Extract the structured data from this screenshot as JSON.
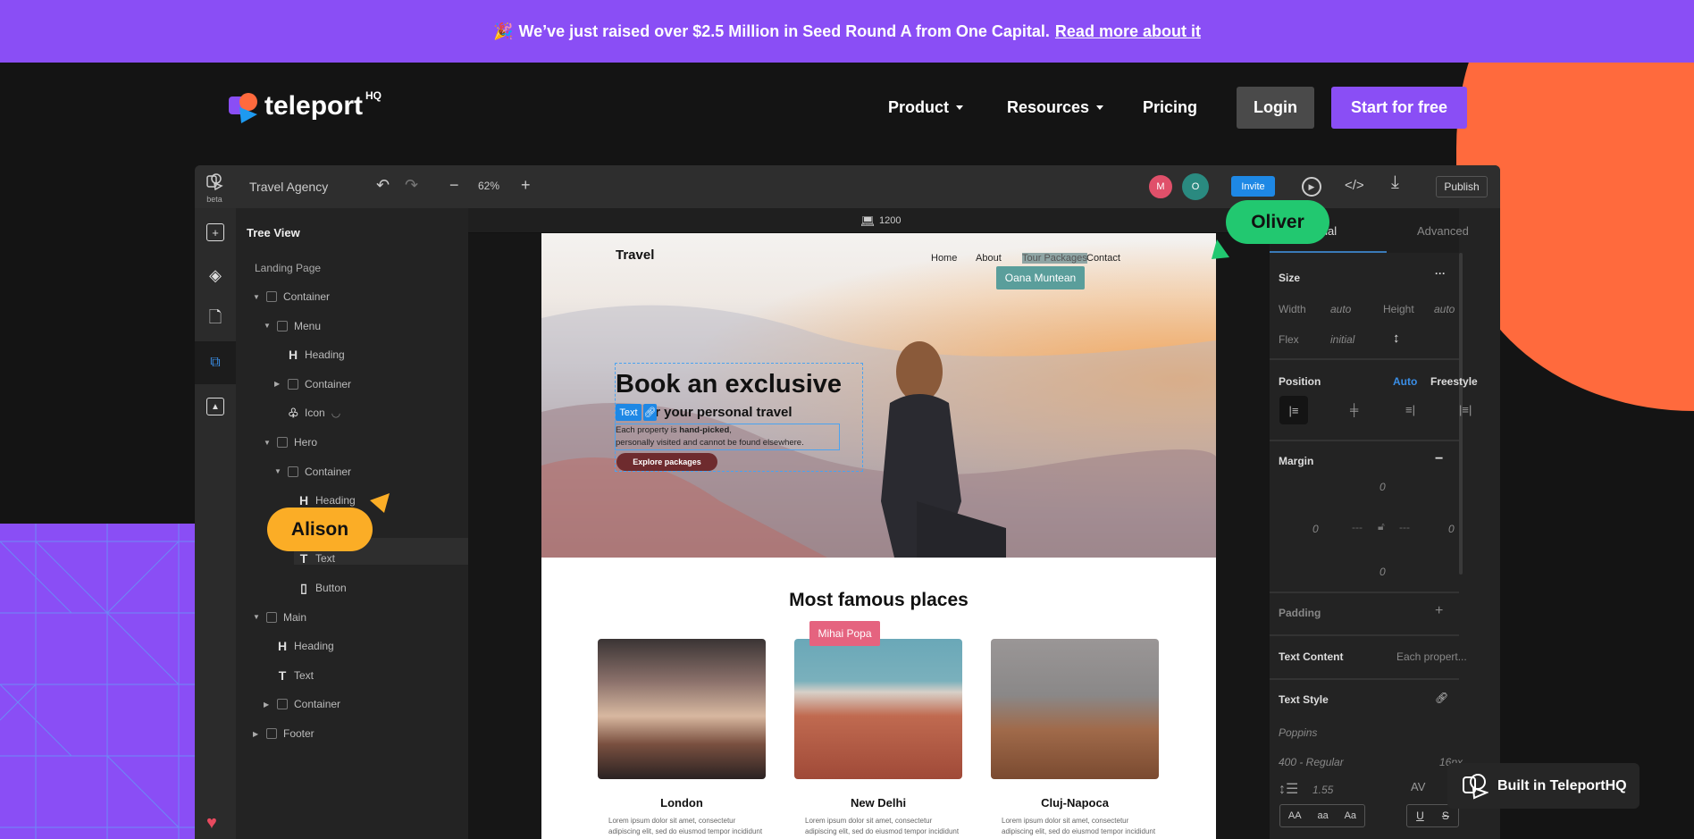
{
  "banner": {
    "emoji": "🎉",
    "text": "We’ve just raised over $2.5 Million in Seed Round A from One Capital.",
    "link": "Read more about it"
  },
  "nav": {
    "logo": "teleport",
    "logo_sup": "HQ",
    "items": [
      {
        "label": "Product",
        "dropdown": true
      },
      {
        "label": "Resources",
        "dropdown": true
      },
      {
        "label": "Pricing",
        "dropdown": false
      }
    ],
    "login": "Login",
    "start": "Start for free"
  },
  "colors": {
    "purple": "#8a4ef5",
    "orange": "#ff6a3d",
    "oliver": "#22c870",
    "alison": "#fbad26",
    "oana": "#5a9e9b",
    "mihai": "#e5637f",
    "accent_blue": "#1e88e5"
  },
  "editor": {
    "beta": "beta",
    "project": "Travel Agency",
    "zoom": "62%",
    "avatars": [
      "M",
      "O"
    ],
    "invite": "Invite",
    "publish": "Publish",
    "viewport_width": "1200",
    "tree": {
      "title": "Tree View",
      "page": "Landing Page",
      "rows": [
        {
          "label": "Container",
          "icon": "box",
          "caret": "down"
        },
        {
          "label": "Menu",
          "icon": "box",
          "caret": "down"
        },
        {
          "label": "Heading",
          "icon": "H"
        },
        {
          "label": "Container",
          "icon": "box",
          "caret": "right"
        },
        {
          "label": "Icon",
          "icon": "shapes",
          "hidden": true
        },
        {
          "label": "Hero",
          "icon": "box",
          "caret": "down"
        },
        {
          "label": "Container",
          "icon": "box",
          "caret": "down"
        },
        {
          "label": "Heading",
          "icon": "H"
        },
        {
          "label": "Text",
          "icon": "T",
          "selected": true
        },
        {
          "label": "Button",
          "icon": "button"
        },
        {
          "label": "Main",
          "icon": "box",
          "caret": "down"
        },
        {
          "label": "Heading",
          "icon": "H"
        },
        {
          "label": "Text",
          "icon": "T"
        },
        {
          "label": "Container",
          "icon": "box",
          "caret": "right"
        },
        {
          "label": "Footer",
          "icon": "box",
          "caret": "right"
        }
      ]
    },
    "panel": {
      "tabs": [
        "Visual",
        "Advanced"
      ],
      "active_tab": "Visual",
      "size": "Size",
      "width_label": "Width",
      "width": "auto",
      "height_label": "Height",
      "height": "auto",
      "flex_label": "Flex",
      "flex": "initial",
      "position": "Position",
      "pos_auto": "Auto",
      "pos_free": "Freestyle",
      "margin": "Margin",
      "margin_vals": {
        "top": "0",
        "left": "0",
        "right": "0",
        "bottom": "0"
      },
      "padding": "Padding",
      "text_content": "Text Content",
      "text_content_val": "Each propert...",
      "text_style": "Text Style",
      "font": "Poppins",
      "weight": "400 - Regular",
      "size_px": "16px",
      "line_height": "1.55",
      "case_btns": [
        "AA",
        "aa",
        "Aa"
      ]
    }
  },
  "site": {
    "brand": "Travel",
    "menu": [
      "Home",
      "About",
      "Tour Packages",
      "Contact"
    ],
    "hero_title": "Book an exclusive",
    "hero_sub": "or your personal travel",
    "hero_text_a": "Each property is ",
    "hero_text_b": "hand-picked",
    "hero_text_c": ",",
    "hero_text_d": "personally visited and cannot be found elsewhere.",
    "hero_btn": "Explore packages",
    "text_chip": "Text",
    "section_title": "Most famous places",
    "cards": [
      {
        "title": "London",
        "text": "Lorem ipsum dolor sit amet, consectetur adipiscing elit, sed do eiusmod tempor incididunt ut labore et dolore magna."
      },
      {
        "title": "New Delhi",
        "text": "Lorem ipsum dolor sit amet, consectetur adipiscing elit, sed do eiusmod tempor incididunt ut labore et dolore magna."
      },
      {
        "title": "Cluj-Napoca",
        "text": "Lorem ipsum dolor sit amet, consectetur adipiscing elit, sed do eiusmod tempor incididunt ut labore et dolore magna."
      }
    ]
  },
  "cursors": {
    "oliver": "Oliver",
    "alison": "Alison",
    "oana": "Oana Muntean",
    "mihai": "Mihai Popa"
  },
  "badge": "Built in TeleportHQ"
}
